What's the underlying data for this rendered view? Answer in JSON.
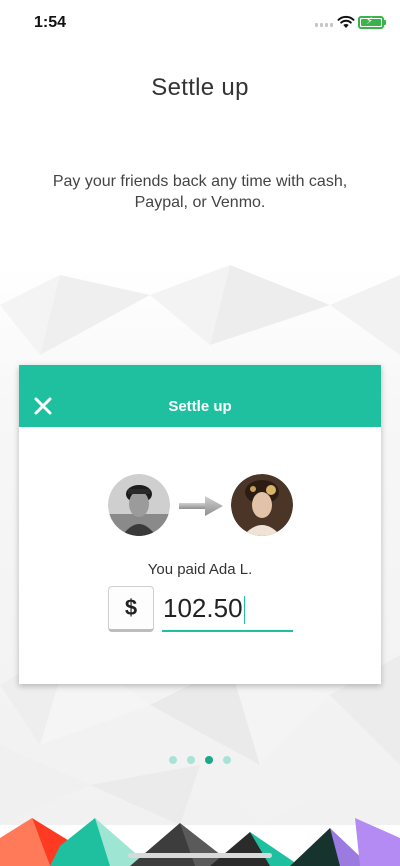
{
  "status_bar": {
    "time": "1:54"
  },
  "onboarding": {
    "title": "Settle up",
    "subtitle": "Pay your friends back any time with cash, Paypal, or Venmo.",
    "page_count": 4,
    "active_page": 3
  },
  "card": {
    "header_title": "Settle up",
    "paid_text": "You paid Ada L.",
    "currency_symbol": "$",
    "amount": "102.50"
  },
  "icons": {
    "close": "close-icon",
    "arrow": "arrow-right-icon",
    "from_avatar": "avatar",
    "to_avatar": "avatar"
  },
  "colors": {
    "accent": "#1fc0a0",
    "pager_active": "#1aa889",
    "pager_inactive": "#a8e3d5",
    "battery": "#3ab34a"
  }
}
